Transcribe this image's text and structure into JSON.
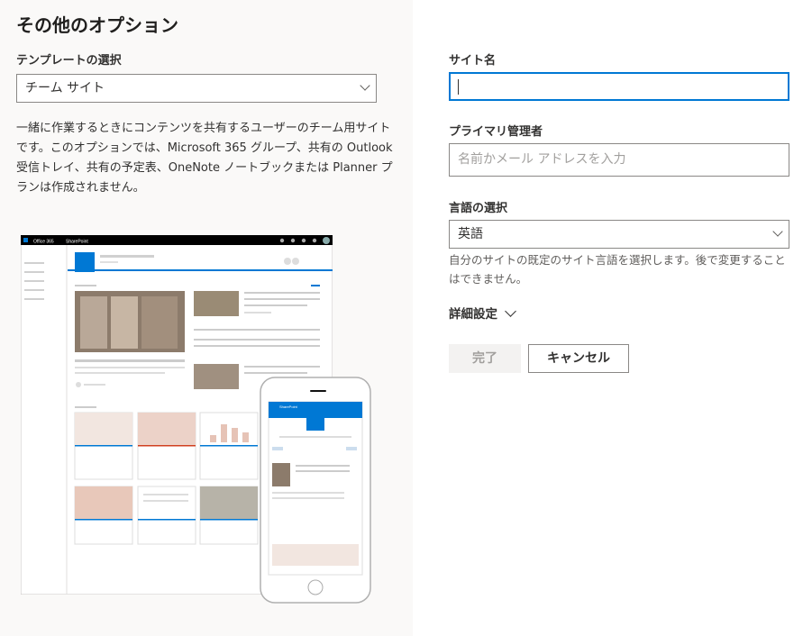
{
  "page": {
    "title": "その他のオプション"
  },
  "template": {
    "label": "テンプレートの選択",
    "selected": "チーム サイト",
    "description": "一緒に作業するときにコンテンツを共有するユーザーのチーム用サイトです。このオプションでは、Microsoft 365 グループ、共有の Outlook 受信トレイ、共有の予定表、OneNote ノートブックまたは Planner プランは作成されません。"
  },
  "preview": {
    "office_label": "Office 365",
    "sharepoint_label": "SharePoint",
    "phone_status": "SharePoint"
  },
  "form": {
    "site_name_label": "サイト名",
    "site_name_value": "",
    "admin_label": "プライマリ管理者",
    "admin_placeholder": "名前かメール アドレスを入力",
    "language_label": "言語の選択",
    "language_value": "英語",
    "language_help": "自分のサイトの既定のサイト言語を選択します。後で変更することはできません。",
    "advanced_label": "詳細設定",
    "done_button": "完了",
    "cancel_button": "キャンセル"
  },
  "colors": {
    "accent": "#0078d4",
    "left_bg": "#faf9f8",
    "disabled_bg": "#f3f2f1"
  }
}
